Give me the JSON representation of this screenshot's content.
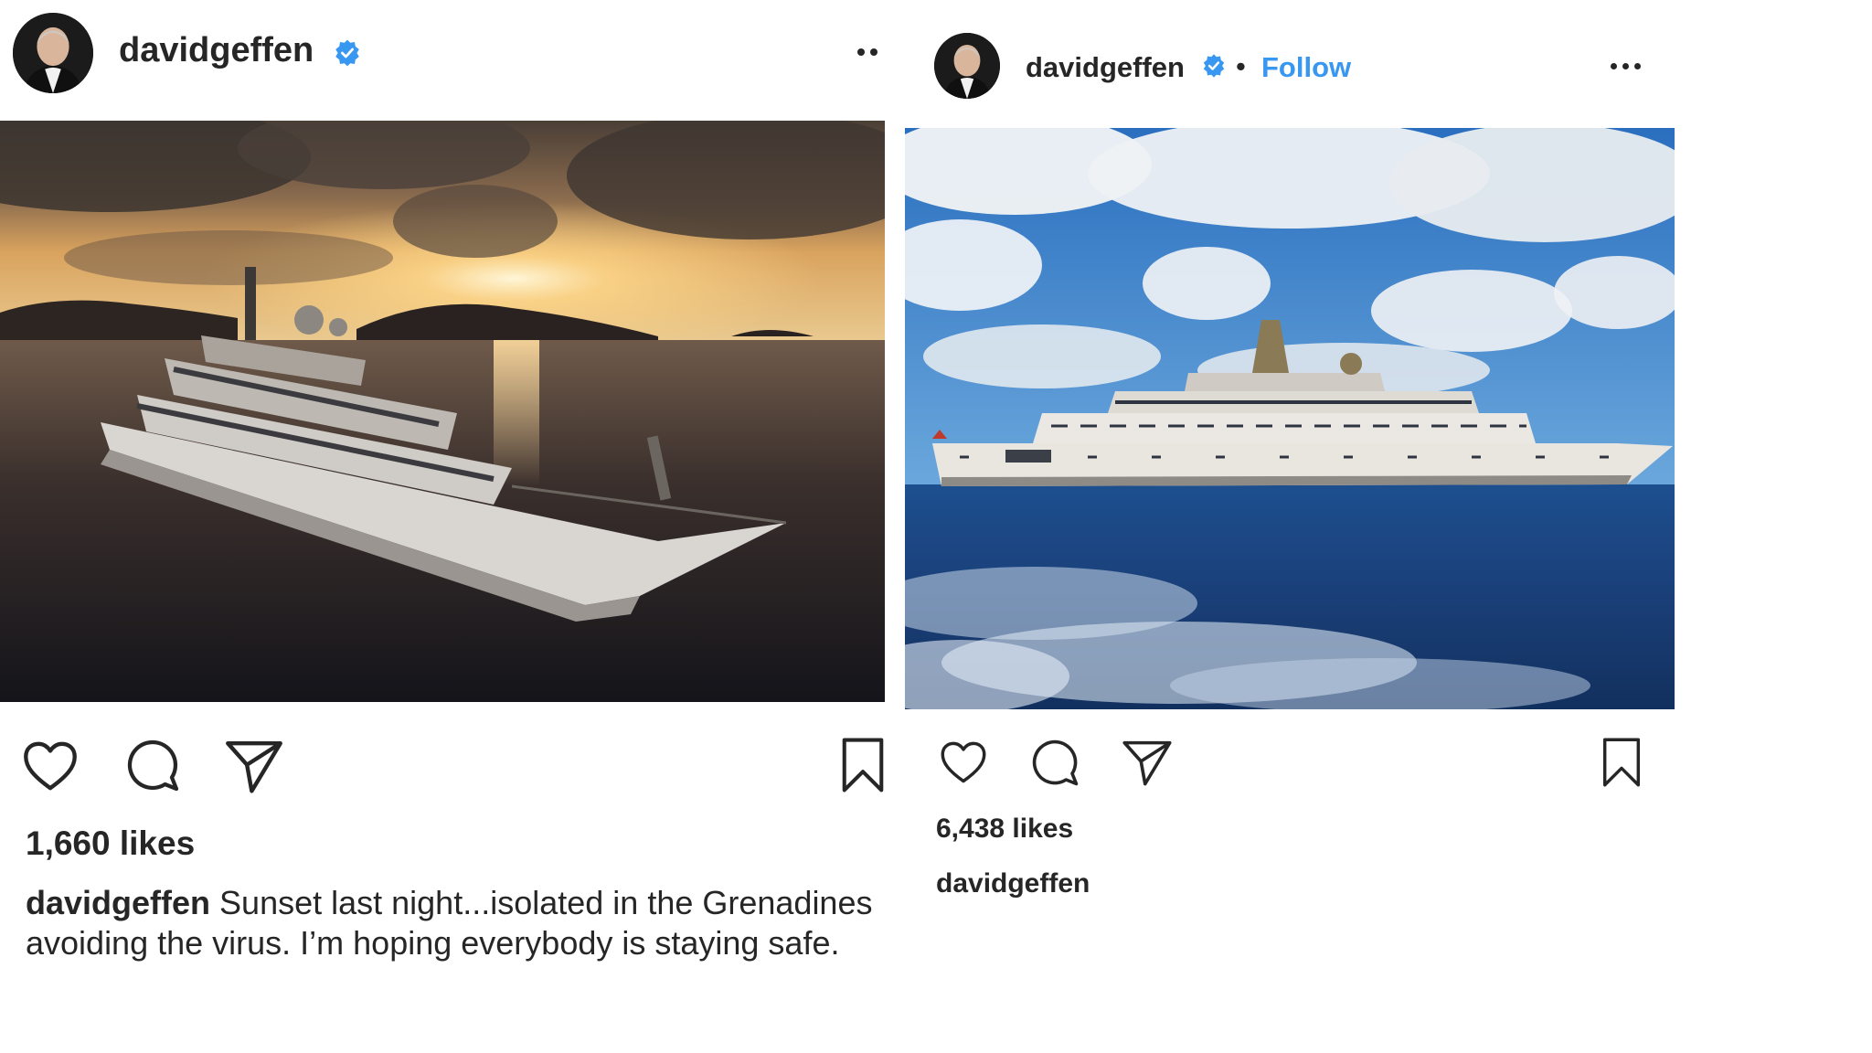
{
  "colors": {
    "text": "#262626",
    "verified_badge": "#3897f0",
    "follow_link": "#3897f0"
  },
  "post_left": {
    "username": "davidgeffen",
    "verified": true,
    "avatar_icon": "profile-photo",
    "more_icon": "more-options-icon",
    "actions": [
      "heart-icon",
      "comment-icon",
      "share-icon",
      "bookmark-icon"
    ],
    "likes": "1,660 likes",
    "caption_user": "davidgeffen",
    "caption_text": " Sunset last night...isolated in the Grenadines avoiding the virus.  I’m hoping everybody is staying safe."
  },
  "post_right": {
    "username": "davidgeffen",
    "verified": true,
    "separator": "•",
    "follow": "Follow",
    "avatar_icon": "profile-photo",
    "more_icon": "more-options-icon",
    "actions": [
      "heart-icon",
      "comment-icon",
      "share-icon",
      "bookmark-icon"
    ],
    "likes": "6,438 likes",
    "caption_user": "davidgeffen"
  }
}
